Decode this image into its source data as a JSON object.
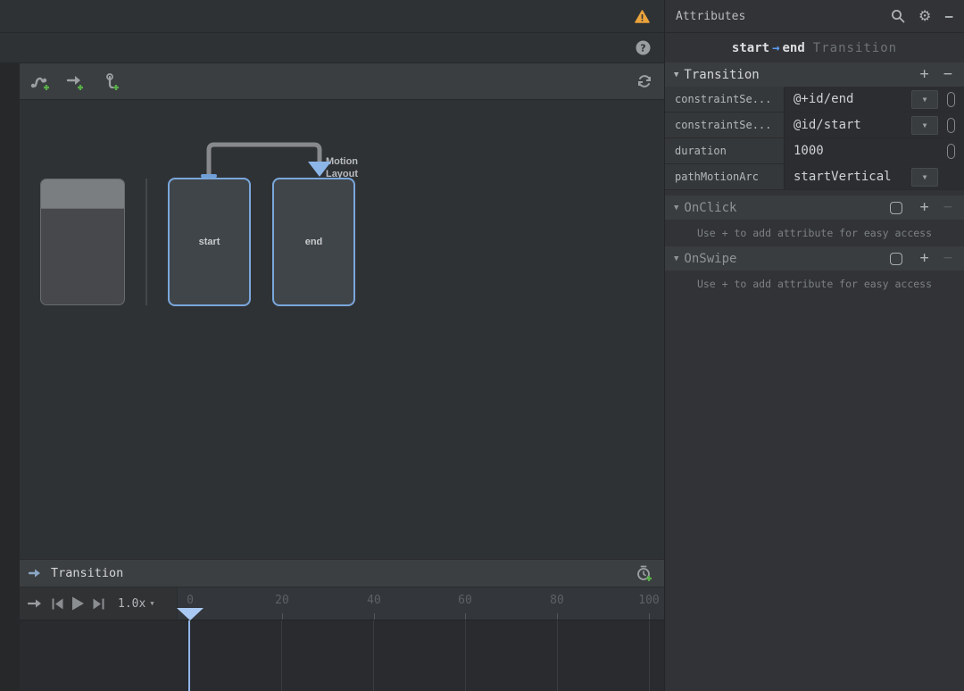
{
  "attributes_panel": {
    "title": "Attributes",
    "subtitle": {
      "from": "start",
      "arrow": "→",
      "to": "end",
      "kind": "Transition"
    },
    "transition_section": {
      "label": "Transition",
      "rows": [
        {
          "label": "constraintSe...",
          "value": "@+id/end"
        },
        {
          "label": "constraintSe...",
          "value": "@id/start"
        },
        {
          "label": "duration",
          "value": "1000"
        },
        {
          "label": "pathMotionArc",
          "value": "startVertical"
        }
      ]
    },
    "onclick_section": {
      "label": "OnClick",
      "hint": "Use + to add attribute for easy access"
    },
    "onswipe_section": {
      "label": "OnSwipe",
      "hint": "Use + to add attribute for easy access"
    }
  },
  "canvas": {
    "motion_layout_label": "Motion Layout",
    "start_label": "start",
    "end_label": "end"
  },
  "timeline": {
    "panel_title": "Transition",
    "speed": "1.0x",
    "ticks": [
      "0",
      "20",
      "40",
      "60",
      "80",
      "100"
    ]
  },
  "glyphs": {
    "section_collapse": "▼",
    "plus": "+",
    "minus": "−",
    "dropdown_caret": "▼",
    "speed_caret": "▼",
    "gear": "⚙",
    "help": "?"
  },
  "colors": {
    "accent_blue": "#5c9cf5",
    "state_border_blue": "#7aa7dc",
    "playhead_blue": "#a9c9f2",
    "warning_orange": "#eba33c",
    "add_green": "#57ad48"
  }
}
